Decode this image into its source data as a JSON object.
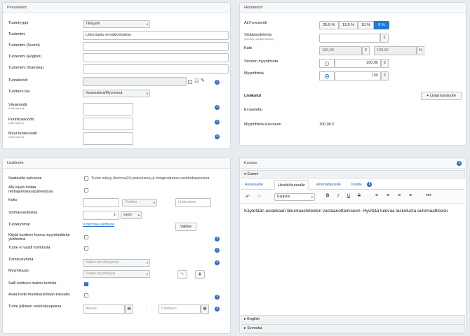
{
  "perustiedot": {
    "title": "Perustiedot",
    "tuotetyyppi_label": "Tuotetyyppi",
    "tuotetyyppi_value": "Tilimyynti",
    "tuotenimi_label": "Tuotenimi",
    "tuotenimi_value": "Liikuntaetu ennakkomaksu",
    "tuotenimi_suomi_label": "Tuotenimi (Suomi)",
    "tuotenimi_english_label": "Tuotenimi (English)",
    "tuotenimi_svenska_label": "Tuotenimi (Svenska)",
    "tuotekoodi_label": "Tuotekoodi",
    "tuotteen_tila_label": "Tuotteen tila",
    "tuotteen_tila_value": "Varastoitava/Myynnissä",
    "viivakoodit_label": "Viivakoodit",
    "viivakoodit_sub": "(Valinnainen)",
    "punnituskoodit_label": "Punnituskoodit",
    "punnituskoodit_sub": "(Valinnainen)",
    "muut_tuotekoodit_label": "Muut tuotekoodit",
    "muut_tuotekoodit_sub": "(Valinnainen)"
  },
  "hintatiedot": {
    "title": "Hintatiedot",
    "alv_label": "ALV-prosentti",
    "alv_options": [
      "25.5 %",
      "13.5 %",
      "10 %",
      "0 %"
    ],
    "alv_selected": "0 %",
    "sisaanostohinta_label": "Sisäänostohinta",
    "sisaanostohinta_sub": "(veroton, vapaaehtoinen)",
    "euro_symbol": "€",
    "percent_symbol": "%",
    "kate_label": "Kate",
    "kate_eur_value": "100,00",
    "kate_pct_value": "100,00",
    "veroton_label": "Veroton myyntihinta",
    "veroton_value": "100,00",
    "myyntihinta_label": "Myyntihinta",
    "myyntihinta_value": "100",
    "lisakulut_label": "Lisäkulut",
    "lisaa_kulutuote_label": "Lisää kulutuote",
    "ei_asetettu": "Ei asetettu",
    "myyntihinta_kuluineen_label": "Myyntihinta kuluineen",
    "myyntihinta_kuluineen_value": "100,00 €"
  },
  "lisatiedot": {
    "title": "Lisätiedot",
    "saatavilla_label": "Saatavilla verkossa",
    "saatavilla_desc": "Tuote näkyy Avoinna24-palvelussa ja integroiduissa verkkokaupoissa.",
    "ala_nayta_label1": "Älä näytä hintaa",
    "ala_nayta_label2": "nettiajanvarauspalvelussa",
    "koko_label": "Koko",
    "koko_unit": "Yksikkö",
    "koko_extra": "Lisämääre",
    "voimassaoloaika_label": "Voimassaoloaika",
    "voimassaoloaika_value": "1",
    "voimassaoloaika_unit": "vuosi",
    "tuoteryhmat_label": "Tuoteryhmät",
    "tuoteryhmat_link": "0 ryhmää valittuna",
    "valitse_label": "Valitse",
    "kayta_label1": "Käytä tuotteen koosa myyntimäärän",
    "kayta_label2": "yksikkönä",
    "tuote_ei_vaadi_label": "Tuote ei vaadi toimitusta",
    "toimitusryhma_label": "Toimitusryhmä",
    "toimitusryhma_value": "Valitse toimitusryhmä",
    "myyntikausi_label": "Myyntikausi",
    "myyntikausi_value": "Valitse myyntikausi",
    "salli_label": "Salli tuotteen maksu luotolla",
    "avaa_label": "Avaa tuote muokkaustilaan kassalla",
    "tuote_julkinen_label": "Tuote julkinen verkkokaupassa",
    "alkaen": "Alkaen",
    "dash": "-",
    "paattyen": "Päättyen"
  },
  "kuvaus": {
    "title": "Kuvaus",
    "suomi": "Suomi",
    "tabs": [
      "Asiakkaille",
      "Henkilökunnalle",
      "Ammattilaisille",
      "Kutille"
    ],
    "active_tab": "Henkilökunnalle",
    "paragraph": "Kappale",
    "body_text": "Käytetään asiakkaan liikuntaseteleiden vastaanottamiseen. Hyvittää tulevaa laskutusta automaattisesti.",
    "english": "English",
    "svenska": "Svenska"
  },
  "colors": {
    "accent": "#1e7ad6",
    "info": "#2a6fc9",
    "link": "#1e6fcc"
  }
}
